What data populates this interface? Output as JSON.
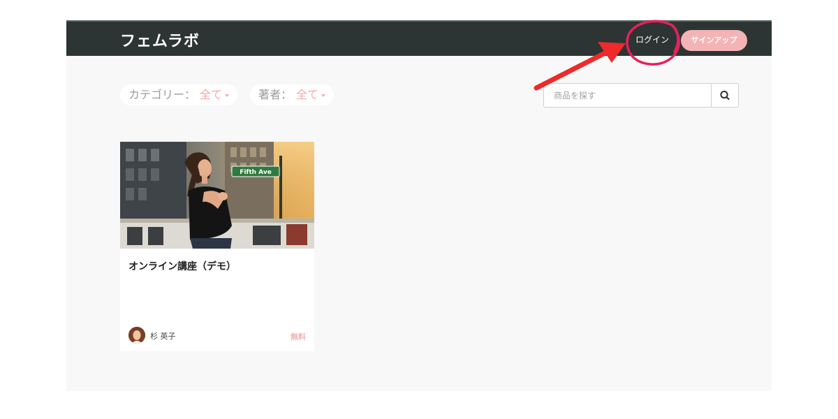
{
  "header": {
    "brand": "フェムラボ",
    "login_label": "ログイン",
    "signup_label": "サインアップ"
  },
  "filters": {
    "category_label": "カテゴリー：",
    "category_value": "全て",
    "author_label": "著者：",
    "author_value": "全て"
  },
  "search": {
    "placeholder": "商品を探す"
  },
  "products": [
    {
      "title": "オンライン講座（デモ）",
      "author": "杉 英子",
      "price": "無料",
      "image_sign_text": "Fifth Ave"
    }
  ],
  "colors": {
    "header_bg": "#2c3533",
    "accent_pink": "#f4b4b6",
    "annotation_red": "#ee2a2a",
    "annotation_circle": "#e8205a"
  }
}
